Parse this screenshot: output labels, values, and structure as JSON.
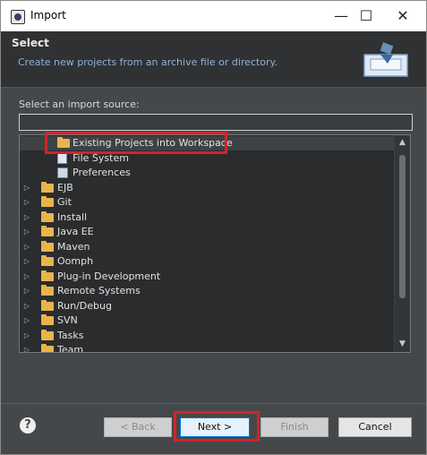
{
  "window": {
    "title": "Import",
    "minimize": "—",
    "maximize": "☐",
    "close": "✕"
  },
  "header": {
    "title": "Select",
    "description": "Create new projects from an archive file or directory."
  },
  "source": {
    "label": "Select an import source:",
    "filter_value": ""
  },
  "tree": {
    "items": [
      {
        "label": "Existing Projects into Workspace",
        "icon": "folder-open-icon",
        "expandable": false,
        "selected": true,
        "child": true
      },
      {
        "label": "File System",
        "icon": "file-system-icon",
        "expandable": false,
        "child": true
      },
      {
        "label": "Preferences",
        "icon": "preferences-icon",
        "expandable": false,
        "child": true
      },
      {
        "label": "EJB",
        "icon": "folder-icon",
        "expandable": true
      },
      {
        "label": "Git",
        "icon": "folder-icon",
        "expandable": true
      },
      {
        "label": "Install",
        "icon": "folder-icon",
        "expandable": true
      },
      {
        "label": "Java EE",
        "icon": "folder-icon",
        "expandable": true
      },
      {
        "label": "Maven",
        "icon": "folder-icon",
        "expandable": true
      },
      {
        "label": "Oomph",
        "icon": "folder-icon",
        "expandable": true
      },
      {
        "label": "Plug-in Development",
        "icon": "folder-icon",
        "expandable": true
      },
      {
        "label": "Remote Systems",
        "icon": "folder-icon",
        "expandable": true
      },
      {
        "label": "Run/Debug",
        "icon": "folder-icon",
        "expandable": true
      },
      {
        "label": "SVN",
        "icon": "folder-icon",
        "expandable": true
      },
      {
        "label": "Tasks",
        "icon": "folder-icon",
        "expandable": true
      },
      {
        "label": "Team",
        "icon": "folder-icon",
        "expandable": true
      }
    ]
  },
  "buttons": {
    "help": "?",
    "back": "< Back",
    "next": "Next >",
    "finish": "Finish",
    "cancel": "Cancel"
  },
  "colors": {
    "highlight": "#d4232b",
    "accent": "#0078d7",
    "folder": "#e9b44c"
  }
}
